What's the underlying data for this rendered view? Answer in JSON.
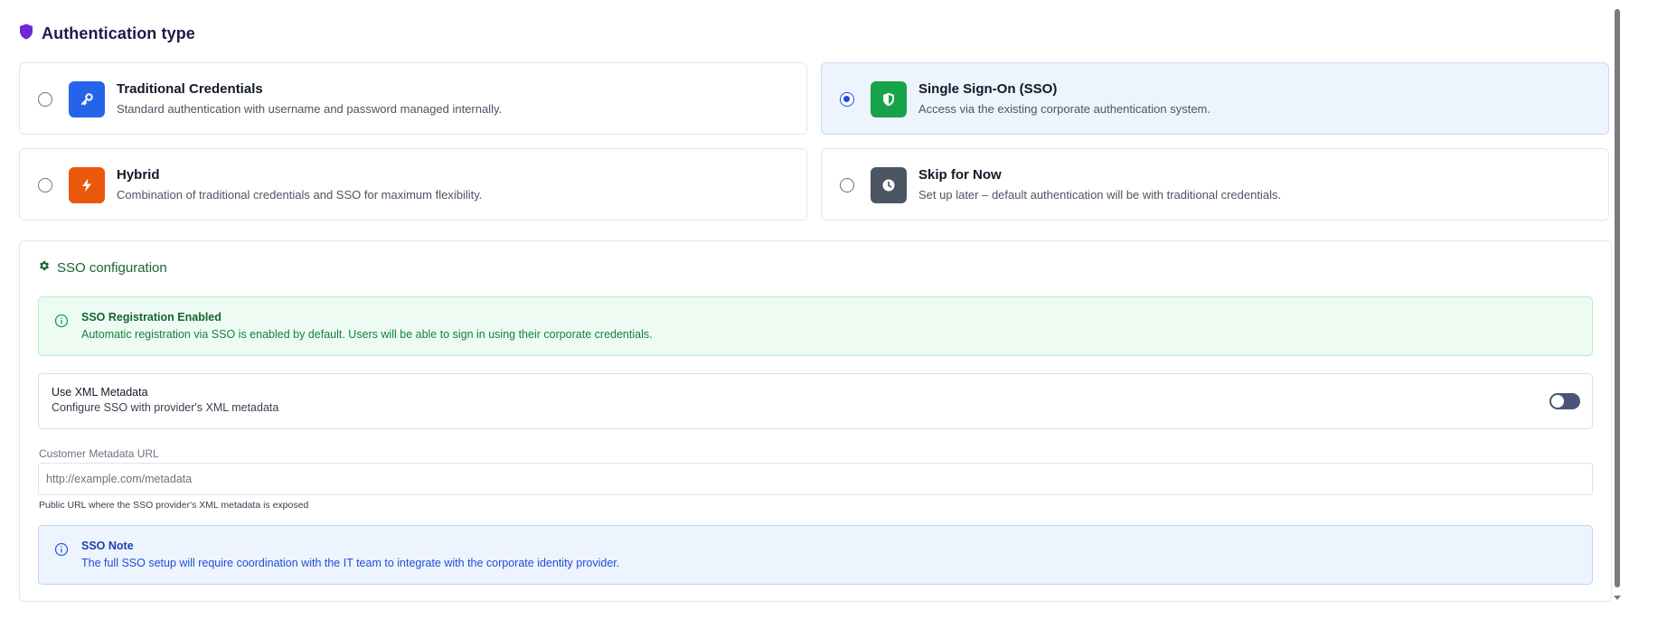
{
  "section": {
    "title": "Authentication type"
  },
  "options": [
    {
      "title": "Traditional Credentials",
      "description": "Standard authentication with username and password managed internally.",
      "icon": "key-icon",
      "color": "#2563eb",
      "selected": false
    },
    {
      "title": "Single Sign-On (SSO)",
      "description": "Access via the existing corporate authentication system.",
      "icon": "shield-icon",
      "color": "#16a34a",
      "selected": true
    },
    {
      "title": "Hybrid",
      "description": "Combination of traditional credentials and SSO for maximum flexibility.",
      "icon": "bolt-icon",
      "color": "#ea580c",
      "selected": false
    },
    {
      "title": "Skip for Now",
      "description": "Set up later – default authentication will be with traditional credentials.",
      "icon": "clock-icon",
      "color": "#4b5563",
      "selected": false
    }
  ],
  "sso": {
    "title": "SSO configuration",
    "registration_alert": {
      "title": "SSO Registration Enabled",
      "text": "Automatic registration via SSO is enabled by default. Users will be able to sign in using their corporate credentials."
    },
    "xml_metadata": {
      "title": "Use XML Metadata",
      "description": "Configure SSO with provider's XML metadata",
      "enabled": false
    },
    "metadata_url": {
      "label": "Customer Metadata URL",
      "placeholder": "http://example.com/metadata",
      "value": "",
      "help": "Public URL where the SSO provider's XML metadata is exposed"
    },
    "note": {
      "title": "SSO Note",
      "text": "The full SSO setup will require coordination with the IT team to integrate with the corporate identity provider."
    }
  },
  "colors": {
    "accent_purple": "#6d28d9",
    "green": "#166534",
    "blue": "#1d4ed8"
  }
}
